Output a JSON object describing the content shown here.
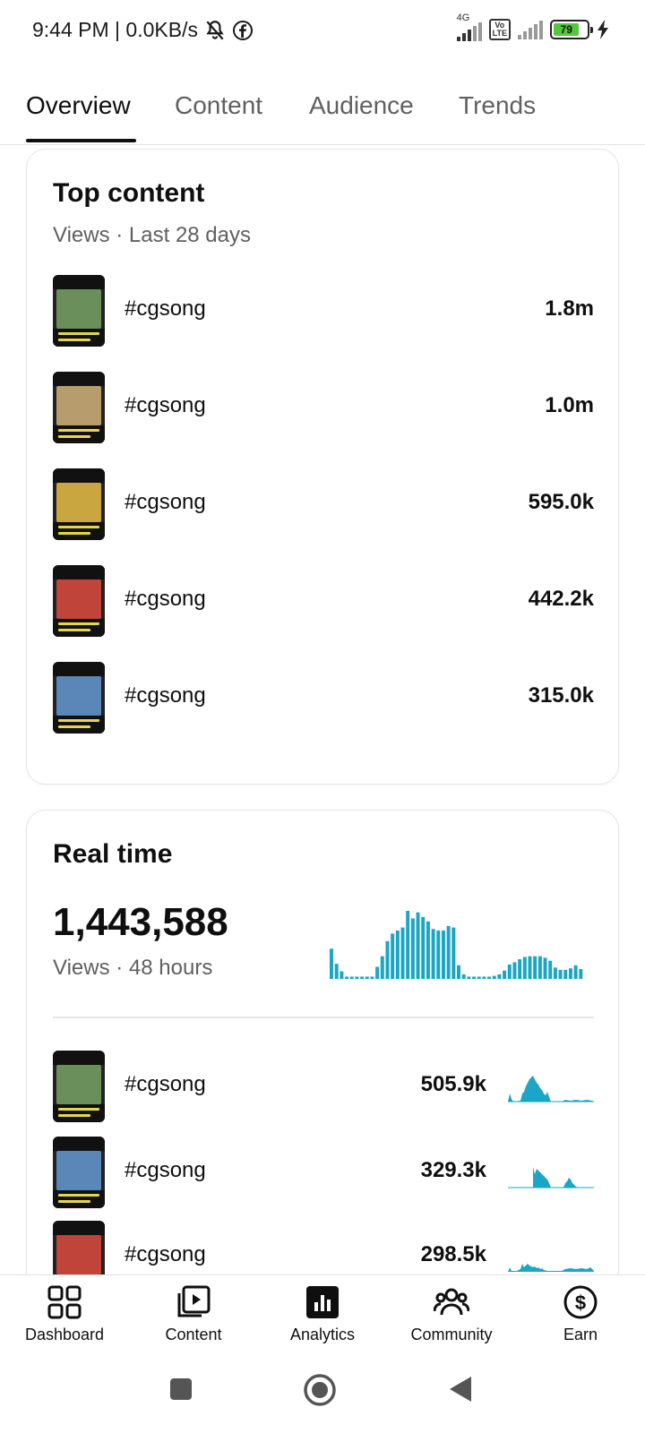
{
  "status_bar": {
    "time_text": "9:44 PM | 0.0KB/s",
    "network": "4G",
    "volte_line1": "Vo",
    "volte_line2": "LTE",
    "battery": "79"
  },
  "tabs": [
    {
      "label": "Overview",
      "active": true
    },
    {
      "label": "Content",
      "active": false
    },
    {
      "label": "Audience",
      "active": false
    },
    {
      "label": "Trends",
      "active": false
    }
  ],
  "top_content": {
    "title": "Top content",
    "subtitle": "Views · Last 28 days",
    "items": [
      {
        "title": "#cgsong",
        "value": "1.8m",
        "thumb_color": "#6b8f5a"
      },
      {
        "title": "#cgsong",
        "value": "1.0m",
        "thumb_color": "#b79c6e"
      },
      {
        "title": "#cgsong",
        "value": "595.0k",
        "thumb_color": "#c9a640"
      },
      {
        "title": "#cgsong",
        "value": "442.2k",
        "thumb_color": "#c0443a"
      },
      {
        "title": "#cgsong",
        "value": "315.0k",
        "thumb_color": "#5a86b8"
      }
    ]
  },
  "real_time": {
    "title": "Real time",
    "total": "1,443,588",
    "subtitle": "Views · 48 hours",
    "chart_values": [
      4,
      2,
      1,
      0.3,
      0.3,
      0.3,
      0.3,
      0.3,
      0.3,
      1.6,
      3,
      5,
      6,
      6.4,
      6.8,
      9,
      8,
      8.8,
      8.2,
      7.6,
      6.6,
      6.4,
      6.4,
      7,
      6.8,
      1.8,
      0.6,
      0.3,
      0.3,
      0.3,
      0.3,
      0.3,
      0.4,
      0.6,
      1.1,
      1.9,
      2.2,
      2.6,
      2.9,
      3,
      3,
      3,
      2.8,
      2.4,
      1.5,
      1.2,
      1.2,
      1.4,
      1.8,
      1.3
    ],
    "items": [
      {
        "title": "#cgsong",
        "value": "505.9k",
        "thumb_color": "#6b8f5a"
      },
      {
        "title": "#cgsong",
        "value": "329.3k",
        "thumb_color": "#5a86b8"
      },
      {
        "title": "#cgsong",
        "value": "298.5k",
        "thumb_color": "#c0443a"
      }
    ]
  },
  "bottom_nav": [
    {
      "label": "Dashboard",
      "icon": "dashboard-icon"
    },
    {
      "label": "Content",
      "icon": "content-icon"
    },
    {
      "label": "Analytics",
      "icon": "analytics-icon"
    },
    {
      "label": "Community",
      "icon": "community-icon"
    },
    {
      "label": "Earn",
      "icon": "earn-icon"
    }
  ],
  "colors": {
    "accent": "#1aa6c4",
    "text": "#0f0f0f",
    "secondary": "#606060"
  }
}
